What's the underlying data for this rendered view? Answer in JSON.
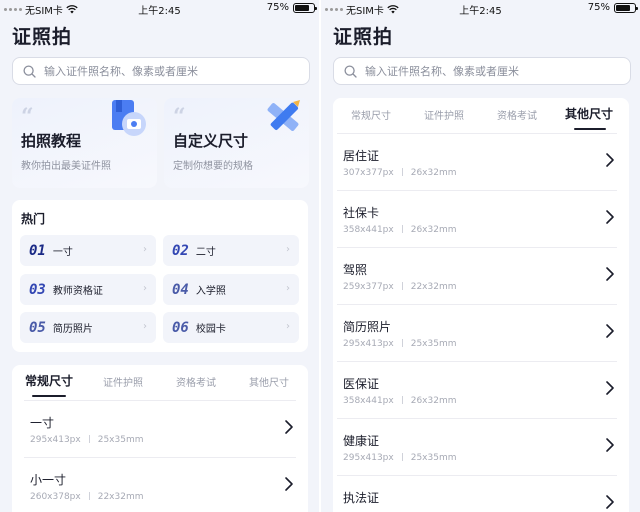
{
  "status_bar": {
    "carrier": "无SIM卡",
    "time": "上午2:45",
    "battery": "75%",
    "battery_level": 0.75
  },
  "app": {
    "title": "证照拍"
  },
  "search": {
    "placeholder": "输入证件照名称、像素或者厘米"
  },
  "features": [
    {
      "title": "拍照教程",
      "subtitle": "教你拍出最美证件照",
      "icon": "book-camera-icon"
    },
    {
      "title": "自定义尺寸",
      "subtitle": "定制你想要的规格",
      "icon": "ruler-pencil-icon"
    }
  ],
  "hot": {
    "title": "热门",
    "items": [
      {
        "num": "01",
        "label": "一寸"
      },
      {
        "num": "02",
        "label": "二寸"
      },
      {
        "num": "03",
        "label": "教师资格证"
      },
      {
        "num": "04",
        "label": "入学照"
      },
      {
        "num": "05",
        "label": "简历照片"
      },
      {
        "num": "06",
        "label": "校园卡"
      }
    ]
  },
  "tabs": [
    "常规尺寸",
    "证件护照",
    "资格考试",
    "其他尺寸"
  ],
  "left_list": {
    "active_tab": "常规尺寸",
    "rows": [
      {
        "title": "一寸",
        "px": "295x413px",
        "mm": "25x35mm"
      },
      {
        "title": "小一寸",
        "px": "260x378px",
        "mm": "22x32mm"
      }
    ]
  },
  "right_list": {
    "active_tab": "其他尺寸",
    "rows": [
      {
        "title": "居住证",
        "px": "307x377px",
        "mm": "26x32mm"
      },
      {
        "title": "社保卡",
        "px": "358x441px",
        "mm": "26x32mm"
      },
      {
        "title": "驾照",
        "px": "259x377px",
        "mm": "22x32mm"
      },
      {
        "title": "简历照片",
        "px": "295x413px",
        "mm": "25x35mm"
      },
      {
        "title": "医保证",
        "px": "358x441px",
        "mm": "26x32mm"
      },
      {
        "title": "健康证",
        "px": "295x413px",
        "mm": "25x35mm"
      },
      {
        "title": "执法证",
        "px": "",
        "mm": ""
      }
    ]
  },
  "colors": {
    "accent": "#2d3fa8",
    "background": "#f2f4fa",
    "icon_blue": "#3f7bf0"
  }
}
